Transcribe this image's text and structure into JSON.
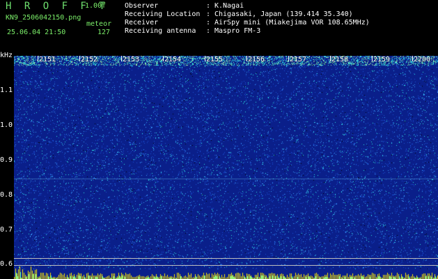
{
  "header": {
    "app_title": "H R O F F T",
    "version": "1.00f",
    "filename": "KN9_2506042150.png",
    "meteor_label": "meteor",
    "datetime": "25.06.04 21:50",
    "count": "127"
  },
  "info": [
    {
      "label": "Observer",
      "value": "K.Nagai"
    },
    {
      "label": "Receiving Location",
      "value": "Chigasaki, Japan (139.414 35.340)"
    },
    {
      "label": "Receiver",
      "value": "AirSpy mini (Miakejima VOR 108.65MHz)"
    },
    {
      "label": "Receiving antenna",
      "value": "Maspro FM-3"
    }
  ],
  "axes": {
    "y_unit": "kHz",
    "y_ticks": [
      "1.1",
      "1.0",
      "0.9",
      "0.8",
      "0.7",
      "0.6"
    ],
    "x_ticks": [
      "2151",
      "2152",
      "2153",
      "2154",
      "2155",
      "2156",
      "2157",
      "2158",
      "2159",
      "2200"
    ]
  },
  "colors": {
    "background": "#000000",
    "spectrogram_base": "#0a1f8a",
    "noise_light": "#3aa0ff",
    "noise_cyan": "#2ef0e6",
    "bar_yellow": "#ffea00",
    "header_green": "#7cf06a"
  }
}
